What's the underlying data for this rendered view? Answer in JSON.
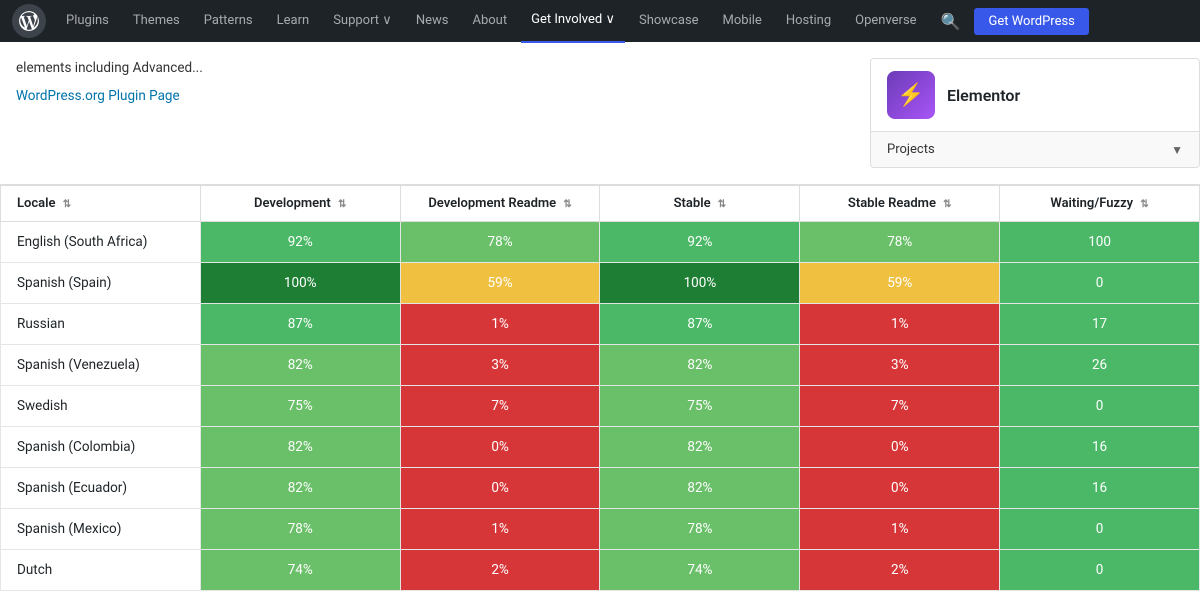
{
  "nav": {
    "links": [
      {
        "label": "Plugins",
        "active": false
      },
      {
        "label": "Themes",
        "active": false
      },
      {
        "label": "Patterns",
        "active": false
      },
      {
        "label": "Learn",
        "active": false
      },
      {
        "label": "Support ∨",
        "active": false
      },
      {
        "label": "News",
        "active": false
      },
      {
        "label": "About",
        "active": false
      },
      {
        "label": "Get Involved ∨",
        "active": true
      },
      {
        "label": "Showcase",
        "active": false
      },
      {
        "label": "Mobile",
        "active": false
      },
      {
        "label": "Hosting",
        "active": false
      },
      {
        "label": "Openverse",
        "active": false
      }
    ],
    "cta": "Get WordPress"
  },
  "top": {
    "description": "elements including Advanced...",
    "plugin_page_link": "WordPress.org Plugin Page",
    "plugin": {
      "name": "Elementor",
      "icon_emoji": "⚡"
    },
    "projects_label": "Projects"
  },
  "table": {
    "columns": [
      {
        "label": "Locale"
      },
      {
        "label": "Development"
      },
      {
        "label": "Development Readme"
      },
      {
        "label": "Stable"
      },
      {
        "label": "Stable Readme"
      },
      {
        "label": "Waiting/Fuzzy"
      }
    ],
    "rows": [
      {
        "locale": "English (South Africa)",
        "development": "92%",
        "dev_class": "cell-green-dark",
        "dev_readme": "78%",
        "dev_readme_class": "cell-green-mid",
        "stable": "92%",
        "stable_class": "cell-green-dark",
        "stable_readme": "78%",
        "stable_readme_class": "cell-green-mid",
        "waiting": "100",
        "waiting_class": "cell-green-dark"
      },
      {
        "locale": "Spanish (Spain)",
        "development": "100%",
        "dev_class": "cell-green-100",
        "dev_readme": "59%",
        "dev_readme_class": "cell-yellow",
        "stable": "100%",
        "stable_class": "cell-green-100",
        "stable_readme": "59%",
        "stable_readme_class": "cell-yellow",
        "waiting": "0",
        "waiting_class": "cell-green-dark"
      },
      {
        "locale": "Russian",
        "development": "87%",
        "dev_class": "cell-green-dark",
        "dev_readme": "1%",
        "dev_readme_class": "cell-red",
        "stable": "87%",
        "stable_class": "cell-green-dark",
        "stable_readme": "1%",
        "stable_readme_class": "cell-red",
        "waiting": "17",
        "waiting_class": "cell-green-dark"
      },
      {
        "locale": "Spanish (Venezuela)",
        "development": "82%",
        "dev_class": "cell-green-mid",
        "dev_readme": "3%",
        "dev_readme_class": "cell-red",
        "stable": "82%",
        "stable_class": "cell-green-mid",
        "stable_readme": "3%",
        "stable_readme_class": "cell-red",
        "waiting": "26",
        "waiting_class": "cell-green-dark"
      },
      {
        "locale": "Swedish",
        "development": "75%",
        "dev_class": "cell-green-mid",
        "dev_readme": "7%",
        "dev_readme_class": "cell-red",
        "stable": "75%",
        "stable_class": "cell-green-mid",
        "stable_readme": "7%",
        "stable_readme_class": "cell-red",
        "waiting": "0",
        "waiting_class": "cell-green-dark"
      },
      {
        "locale": "Spanish (Colombia)",
        "development": "82%",
        "dev_class": "cell-green-mid",
        "dev_readme": "0%",
        "dev_readme_class": "cell-red",
        "stable": "82%",
        "stable_class": "cell-green-mid",
        "stable_readme": "0%",
        "stable_readme_class": "cell-red",
        "waiting": "16",
        "waiting_class": "cell-green-dark"
      },
      {
        "locale": "Spanish (Ecuador)",
        "development": "82%",
        "dev_class": "cell-green-mid",
        "dev_readme": "0%",
        "dev_readme_class": "cell-red",
        "stable": "82%",
        "stable_class": "cell-green-mid",
        "stable_readme": "0%",
        "stable_readme_class": "cell-red",
        "waiting": "16",
        "waiting_class": "cell-green-dark"
      },
      {
        "locale": "Spanish (Mexico)",
        "development": "78%",
        "dev_class": "cell-green-mid",
        "dev_readme": "1%",
        "dev_readme_class": "cell-red",
        "stable": "78%",
        "stable_class": "cell-green-mid",
        "stable_readme": "1%",
        "stable_readme_class": "cell-red",
        "waiting": "0",
        "waiting_class": "cell-green-dark"
      },
      {
        "locale": "Dutch",
        "development": "74%",
        "dev_class": "cell-green-mid",
        "dev_readme": "2%",
        "dev_readme_class": "cell-red",
        "stable": "74%",
        "stable_class": "cell-green-mid",
        "stable_readme": "2%",
        "stable_readme_class": "cell-red",
        "waiting": "0",
        "waiting_class": "cell-green-dark"
      }
    ]
  }
}
